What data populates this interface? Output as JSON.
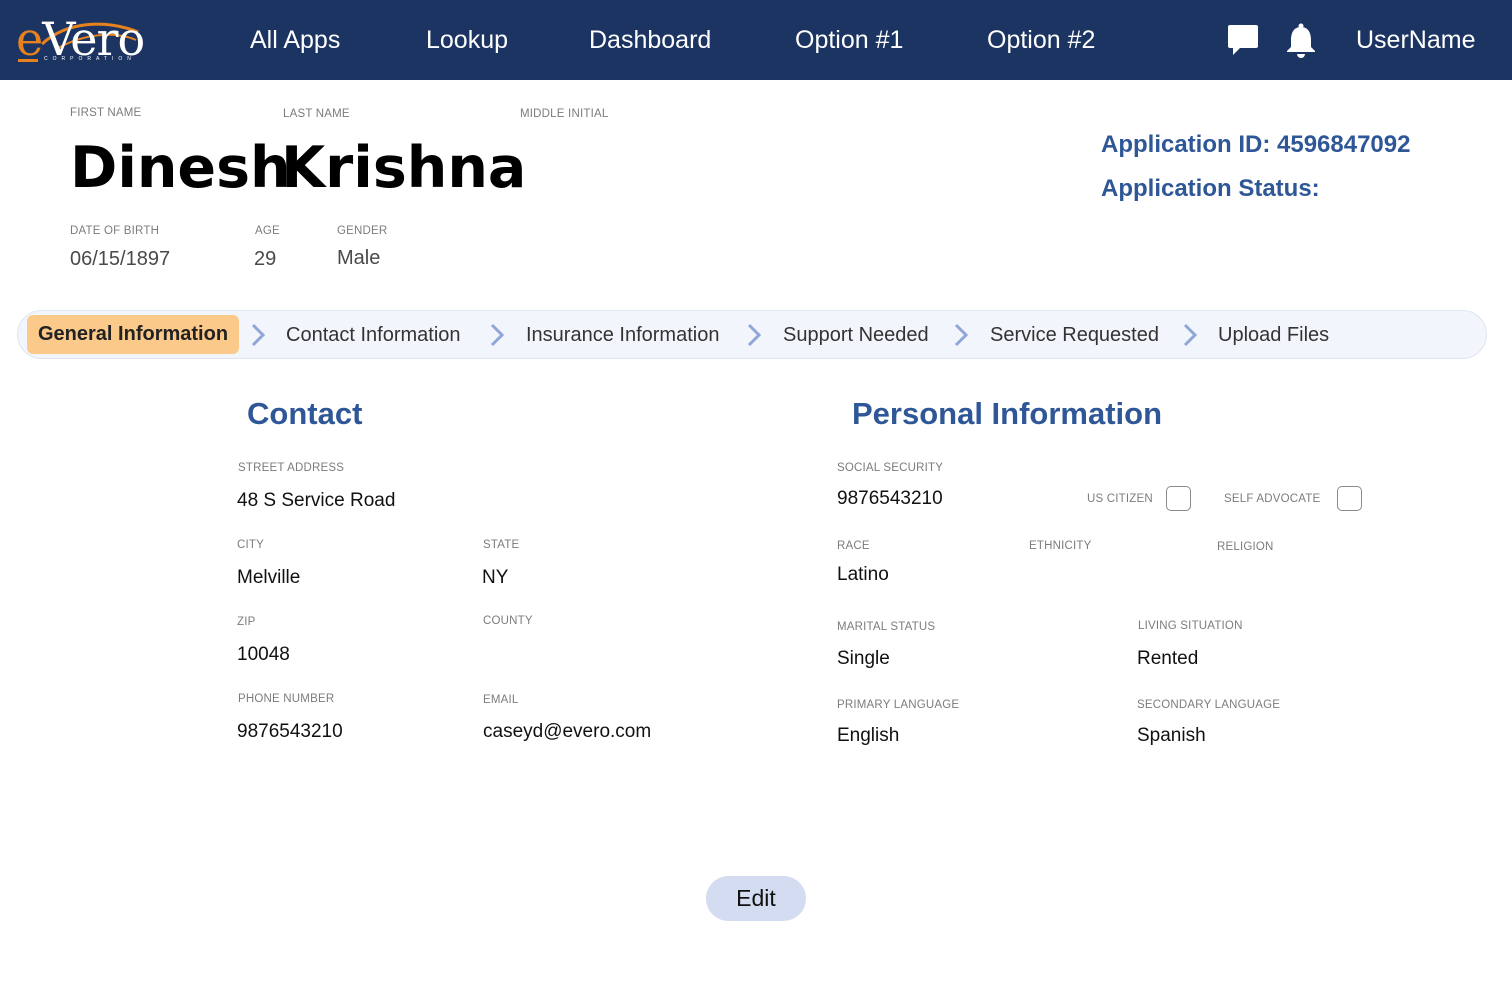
{
  "header": {
    "logo": {
      "text_e": "e",
      "text_rest": "Vero",
      "sub": "CORPORATION"
    },
    "nav": [
      "All Apps",
      "Lookup",
      "Dashboard",
      "Option #1",
      "Option #2"
    ],
    "icons": [
      "chat-icon",
      "bell-icon"
    ],
    "username": "UserName",
    "colors": {
      "bar": "#1c3461",
      "accent": "#e8821e"
    }
  },
  "profile": {
    "first_name_label": "FIRST NAME",
    "last_name_label": "LAST NAME",
    "middle_initial_label": "MIDDLE INITIAL",
    "first_name": "Dinesh",
    "last_name": "Krishna",
    "dob_label": "DATE OF BIRTH",
    "dob": "06/15/1897",
    "age_label": "AGE",
    "age": "29",
    "gender_label": "GENDER",
    "gender": "Male"
  },
  "application": {
    "id_text": "Application ID: 4596847092",
    "status_text": "Application Status:"
  },
  "stepper": {
    "steps": [
      "General Information",
      "Contact Information",
      "Insurance Information",
      "Support Needed",
      "Service Requested",
      "Upload Files"
    ],
    "active_index": 0,
    "active_color": "#fbc98a"
  },
  "contact": {
    "title": "Contact",
    "street_label": "STREET ADDRESS",
    "street": "48 S Service Road",
    "city_label": "CITY",
    "city": "Melville",
    "state_label": "STATE",
    "state": "NY",
    "zip_label": "ZIP",
    "zip": "10048",
    "county_label": "COUNTY",
    "phone_label": "PHONE NUMBER",
    "phone": "9876543210",
    "email_label": "EMAIL",
    "email": "caseyd@evero.com"
  },
  "personal": {
    "title": "Personal Information",
    "ssn_label": "SOCIAL SECURITY",
    "ssn": "9876543210",
    "us_citizen_label": "US CITIZEN",
    "us_citizen_checked": false,
    "self_advocate_label": "SELF ADVOCATE",
    "self_advocate_checked": false,
    "race_label": "RACE",
    "race": "Latino",
    "ethnicity_label": "ETHNICITY",
    "religion_label": "RELIGION",
    "marital_label": "MARITAL STATUS",
    "marital": "Single",
    "living_label": "LIVING SITUATION",
    "living": "Rented",
    "primary_lang_label": "PRIMARY LANGUAGE",
    "primary_lang": "English",
    "secondary_lang_label": "SECONDARY LANGUAGE",
    "secondary_lang": "Spanish"
  },
  "actions": {
    "edit_label": "Edit"
  }
}
